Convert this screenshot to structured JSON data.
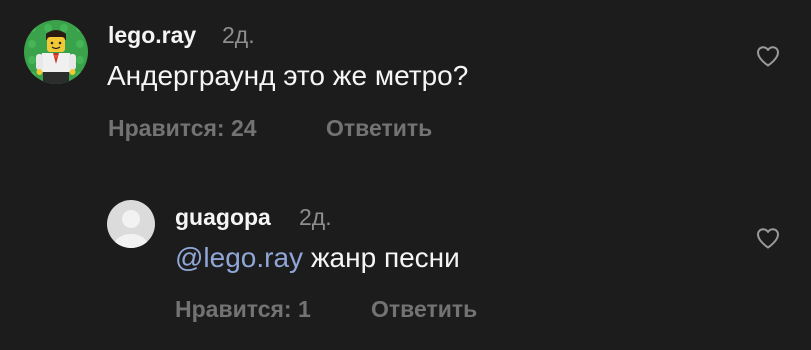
{
  "comments": [
    {
      "username": "lego.ray",
      "time": "2д.",
      "text": "Андерграунд это же метро?",
      "likes_label": "Нравится: 24",
      "reply_label": "Ответить",
      "avatar_icon": "lego-minifigure-avatar",
      "like_icon": "heart-outline-icon"
    },
    {
      "username": "guagopa",
      "time": "2д.",
      "mention": "@lego.ray",
      "text": " жанр песни",
      "likes_label": "Нравится: 1",
      "reply_label": "Ответить",
      "avatar_icon": "default-user-avatar",
      "like_icon": "heart-outline-icon"
    }
  ],
  "colors": {
    "background": "#1c1c1c",
    "primary_text": "#f5f5f5",
    "secondary_text": "#8e8e8e",
    "meta_text": "#737373",
    "mention": "#8fa6d6"
  }
}
